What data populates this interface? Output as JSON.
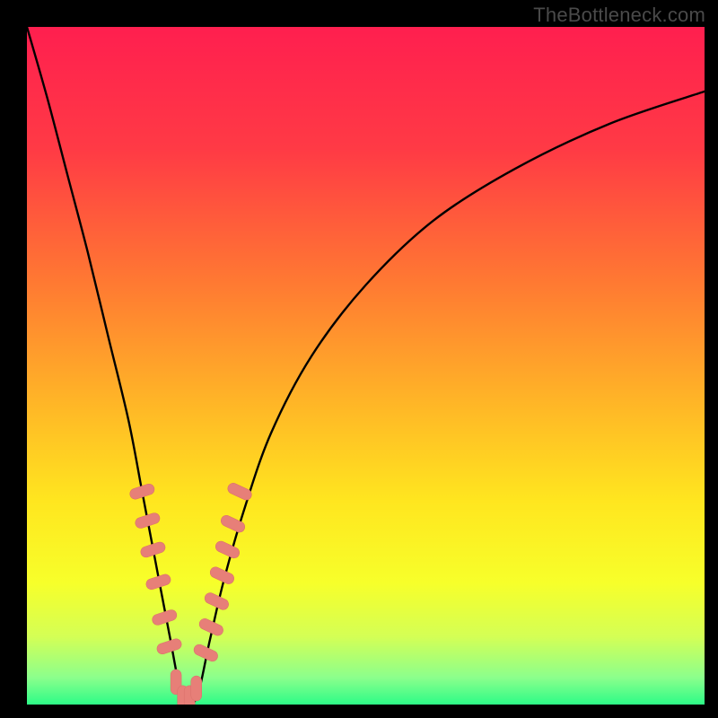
{
  "watermark": "TheBottleneck.com",
  "colors": {
    "frame": "#000000",
    "gradient_stops": [
      {
        "offset": 0.0,
        "color": "#ff1f4f"
      },
      {
        "offset": 0.18,
        "color": "#ff3a45"
      },
      {
        "offset": 0.38,
        "color": "#ff7a32"
      },
      {
        "offset": 0.55,
        "color": "#ffb427"
      },
      {
        "offset": 0.7,
        "color": "#ffe61f"
      },
      {
        "offset": 0.82,
        "color": "#f7ff2a"
      },
      {
        "offset": 0.9,
        "color": "#d4ff55"
      },
      {
        "offset": 0.96,
        "color": "#8cff8c"
      },
      {
        "offset": 1.0,
        "color": "#2dfb87"
      }
    ],
    "curve": "#000000",
    "marker_fill": "#e77f78",
    "marker_stroke": "#d96e68"
  },
  "chart_data": {
    "type": "line",
    "title": "",
    "xlabel": "",
    "ylabel": "",
    "xlim": [
      0,
      100
    ],
    "ylim": [
      0,
      105
    ],
    "optimum_x": 23,
    "series": [
      {
        "name": "bottleneck-curve",
        "x": [
          0,
          3,
          6,
          9,
          12,
          15,
          17,
          19,
          21,
          23,
          25,
          27,
          29,
          32,
          36,
          42,
          50,
          60,
          72,
          86,
          100
        ],
        "values": [
          105,
          94,
          82,
          70,
          57,
          44,
          33,
          22,
          11,
          1,
          1,
          10,
          19,
          30,
          42,
          54,
          65,
          75,
          83,
          90,
          95
        ]
      }
    ],
    "markers": {
      "name": "highlighted-points",
      "x": [
        17.0,
        17.8,
        18.6,
        19.4,
        20.3,
        21.0,
        22.0,
        23.0,
        24.0,
        25.0,
        26.4,
        27.2,
        28.0,
        28.8,
        29.6,
        30.4,
        31.4
      ],
      "values": [
        33.0,
        28.5,
        24.0,
        19.0,
        13.5,
        9.0,
        3.5,
        1.0,
        1.0,
        2.5,
        8.0,
        12.0,
        16.0,
        20.0,
        24.0,
        28.0,
        33.0
      ]
    }
  }
}
